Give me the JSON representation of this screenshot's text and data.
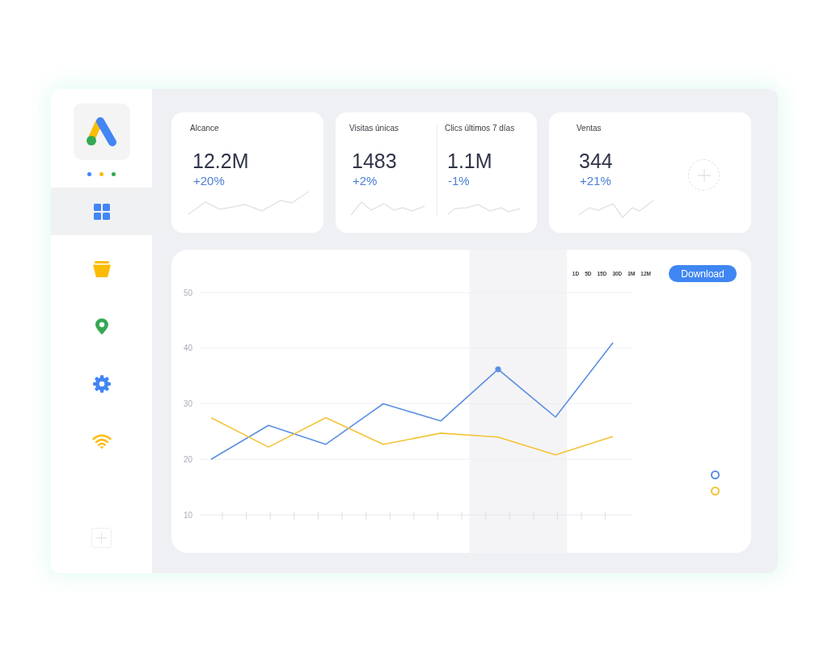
{
  "sidebar": {
    "dots": [
      {
        "color": "#4285f4"
      },
      {
        "color": "#fbbc04"
      },
      {
        "color": "#34a853"
      }
    ],
    "nav_items": [
      {
        "selected": true
      },
      {
        "selected": false
      },
      {
        "selected": false
      },
      {
        "selected": false
      },
      {
        "selected": false
      }
    ]
  },
  "stat_cards": [
    {
      "metrics": [
        {
          "label": "Alcance",
          "value": "12.2M",
          "change": "+20%"
        }
      ]
    },
    {
      "metrics": [
        {
          "label": "Visitas únicas",
          "value": "1483",
          "change": "+2%"
        },
        {
          "label": "Clics últimos 7 días",
          "value": "1.1M",
          "change": "-1%"
        }
      ]
    },
    {
      "metrics": [
        {
          "label": "Ventas",
          "value": "344",
          "change": "+21%"
        }
      ],
      "add_button": true
    }
  ],
  "chart_panel": {
    "range_options": [
      "1D",
      "5D",
      "15D",
      "30D",
      "3M",
      "12M"
    ],
    "download_button": "Download",
    "chart_data": {
      "type": "line",
      "categories": [
        null,
        null,
        null,
        null,
        null,
        null,
        null,
        null
      ],
      "ylim": [
        10,
        50
      ],
      "yticks": [
        10,
        20,
        30,
        40,
        50
      ],
      "grid": true,
      "series": [
        {
          "color": "#5b8fe2",
          "values": [
            20,
            26.1,
            22.7,
            30,
            26.9,
            36.2,
            27.6,
            41
          ]
        },
        {
          "color": "#f3c437",
          "values": [
            27.5,
            22.2,
            27.5,
            22.7,
            24.7,
            24,
            20.8,
            24.1
          ]
        }
      ]
    }
  }
}
